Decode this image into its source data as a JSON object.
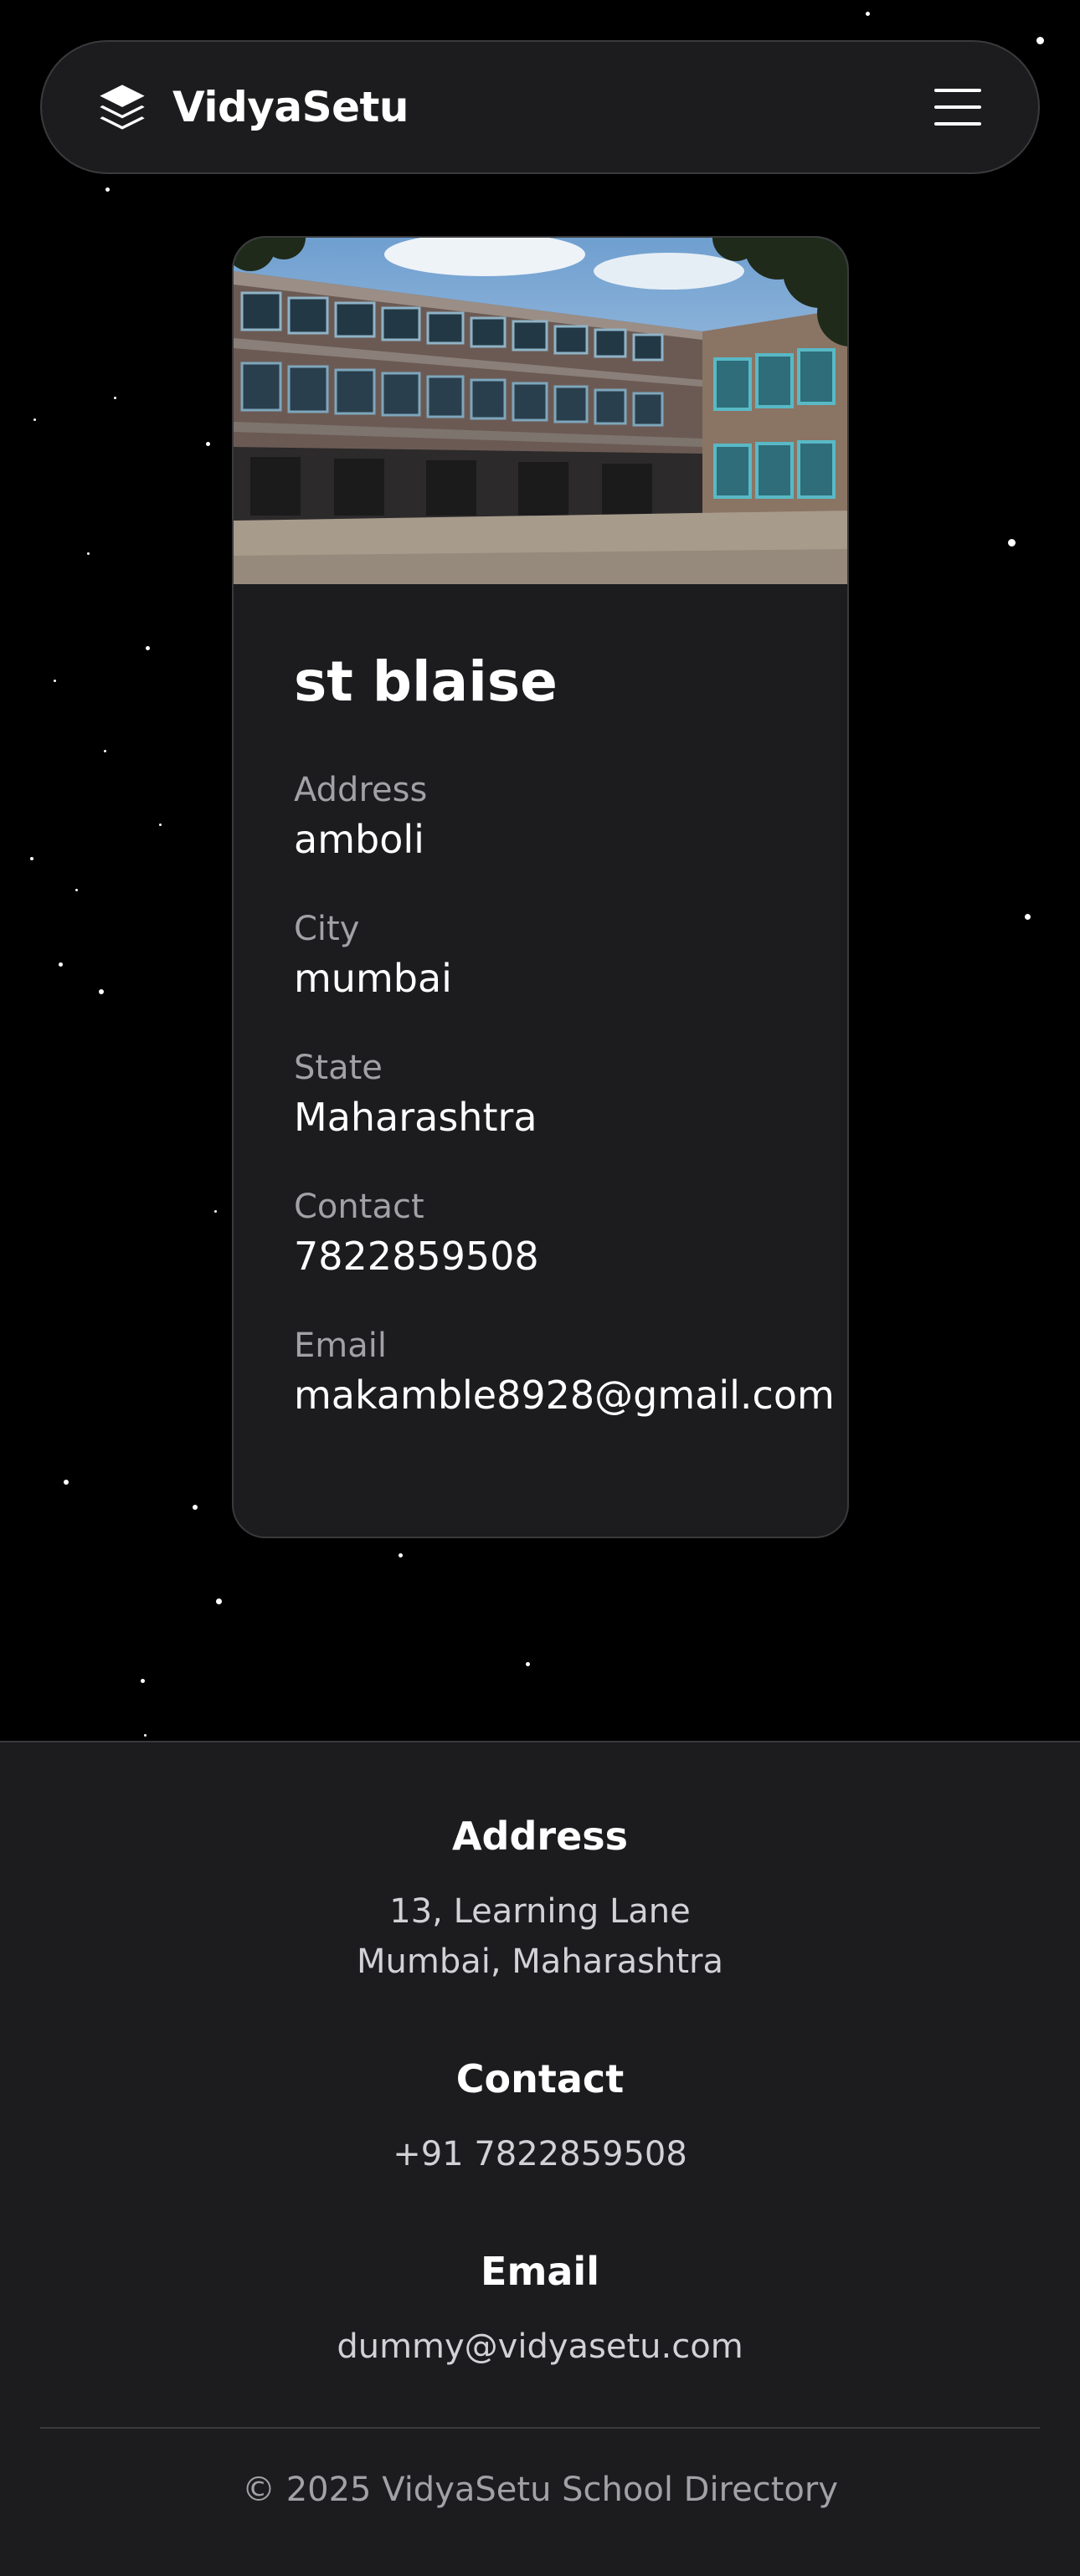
{
  "header": {
    "brand_name": "VidyaSetu",
    "brand_icon": "layers-icon",
    "menu_icon": "hamburger-menu-icon"
  },
  "school": {
    "name": "st blaise",
    "image": "school-building-photo",
    "fields": [
      {
        "label": "Address",
        "value": "amboli"
      },
      {
        "label": "City",
        "value": "mumbai"
      },
      {
        "label": "State",
        "value": "Maharashtra"
      },
      {
        "label": "Contact",
        "value": "7822859508"
      },
      {
        "label": "Email",
        "value": "makamble8928@gmail.com"
      }
    ]
  },
  "footer": {
    "address_title": "Address",
    "address_line1": "13, Learning Lane",
    "address_line2": "Mumbai, Maharashtra",
    "contact_title": "Contact",
    "contact_phone": "+91 7822859508",
    "email_title": "Email",
    "email_value": "dummy@vidyasetu.com",
    "copyright": "© 2025 VidyaSetu School Directory"
  },
  "colors": {
    "background": "#000000",
    "surface": "#1c1c1e",
    "border": "#3a3a3c",
    "muted_text": "#a1a1a6",
    "text": "#ffffff"
  }
}
